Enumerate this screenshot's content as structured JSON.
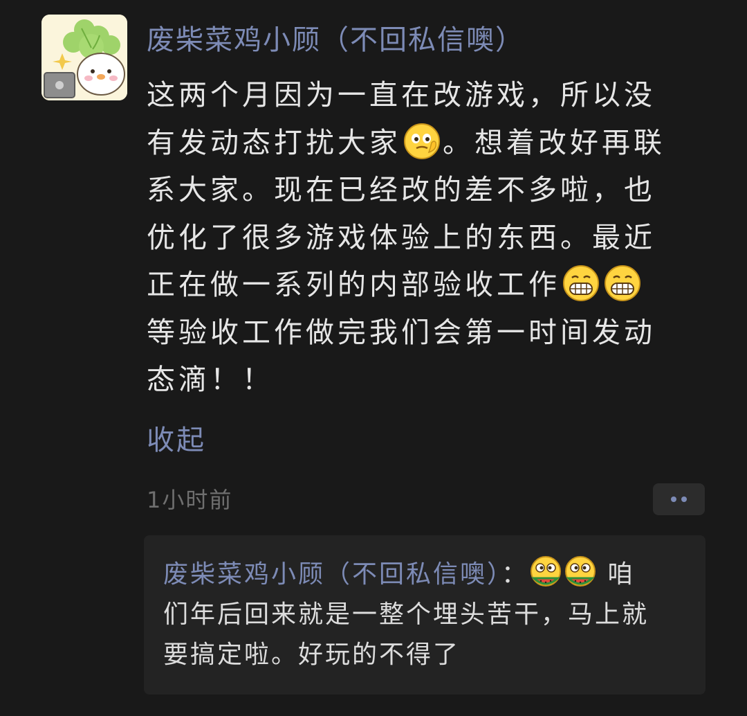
{
  "post": {
    "author": "废柴菜鸡小顾（不回私信噢）",
    "body_lines": [
      "这两个月因为一直在改游戏，所以没",
      "有发动态打扰大家",
      "。想着改好再联",
      "系大家。现在已经改的差不多啦，也",
      "优化了很多游戏体验上的东西。最近",
      "正在做一系列的内部验收工作",
      "等验收工作做完我们会第一时间发动",
      "态滴！！"
    ],
    "collapse_label": "收起",
    "timestamp": "1小时前",
    "emoji_names": [
      "thinking-face-emoji",
      "grin-emoji",
      "grin-emoji"
    ]
  },
  "comment": {
    "author": "废柴菜鸡小顾（不回私信噢）",
    "separator": "：",
    "text_start": "咱",
    "text_line2": "们年后回来就是一整个埋头苦干，马上就",
    "text_line3": "要搞定啦。好玩的不得了",
    "emoji_names": [
      "watermelon-eating-emoji",
      "watermelon-eating-emoji"
    ]
  },
  "colors": {
    "background": "#191919",
    "author_link": "#7d8bb6",
    "body_text": "#e6e6e6",
    "timestamp": "#6f6f6f",
    "comment_panel": "#232323"
  }
}
